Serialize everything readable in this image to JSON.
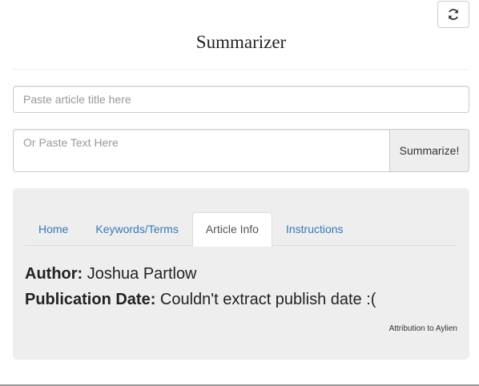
{
  "header": {
    "title": "Summarizer",
    "refresh_icon": "refresh-icon"
  },
  "form": {
    "title_placeholder": "Paste article title here",
    "text_placeholder": "Or Paste Text Here",
    "summarize_label": "Summarize!"
  },
  "tabs": [
    {
      "label": "Home",
      "active": false
    },
    {
      "label": "Keywords/Terms",
      "active": false
    },
    {
      "label": "Article Info",
      "active": true
    },
    {
      "label": "Instructions",
      "active": false
    }
  ],
  "article_info": {
    "author_label": "Author:",
    "author_value": "Joshua Partlow",
    "date_label": "Publication Date:",
    "date_value": "Couldn't extract publish date :("
  },
  "attribution": "Attribution to Aylien",
  "colors": {
    "link": "#337ab7",
    "panel_bg": "#eeeeee",
    "border": "#cccccc"
  }
}
